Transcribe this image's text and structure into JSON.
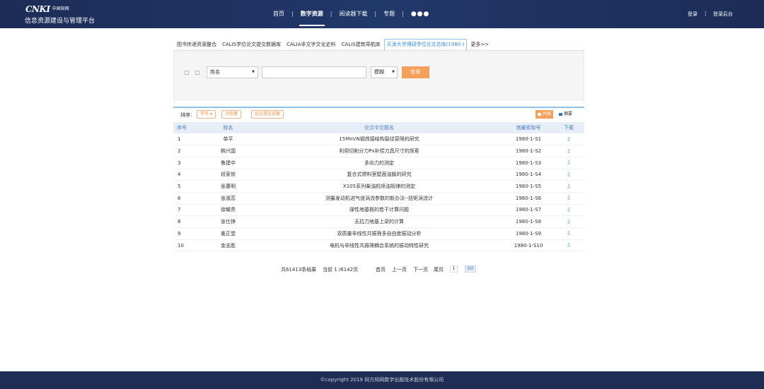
{
  "header": {
    "logo_text": "CNKI",
    "logo_sub": "中国知网",
    "platform": "信息资源建设与管理平台",
    "nav": [
      "首页",
      "数字资源",
      "阅读器下载",
      "专题",
      "●●●"
    ],
    "active_nav": "数字资源",
    "login": "登录",
    "admin": "登录后台"
  },
  "tabs": [
    "图书传递资源整合",
    "CALIS学位论文提交数据库",
    "CALIA非文字文化史料",
    "CALIS建筑导航库",
    "天津大学博硕学位论文总库(1980-)",
    "更多>>"
  ],
  "active_tab": "天津大学博硕学位论文总库(1980-)",
  "search": {
    "field": "姓名",
    "value": "",
    "match": "模糊",
    "button": "检索"
  },
  "sort": {
    "label": "排序:",
    "options": [
      "学号 ▾",
      "浏览量",
      "论文提交日期"
    ],
    "view_list": "列表",
    "view_abstract": "摘要"
  },
  "table": {
    "headers": [
      "序号",
      "姓名",
      "论文中文题名",
      "馆藏索取号",
      "下载"
    ],
    "rows": [
      [
        "1",
        "单平",
        "15MnVN钢焊接结构裂纹容限的研究",
        "1980-1-S1"
      ],
      [
        "2",
        "韩兴国",
        "利用切削分力Px补偿刀具尺寸的探索",
        "1980-1-S2"
      ],
      [
        "3",
        "鲁建中",
        "多向力的测定",
        "1980-1-S3"
      ],
      [
        "4",
        "段家修",
        "复合式燃料室壁面油膜的研究",
        "1980-1-S4"
      ],
      [
        "5",
        "张惠明",
        "X105系列柴油机喷油规律的测定",
        "1980-1-S5"
      ],
      [
        "6",
        "张淑蕊",
        "测量发动机进气道涡流参数的新办法--扭矩涡流计",
        "1980-1-S6"
      ],
      [
        "7",
        "徐耀责",
        "弹性地基板的若干计算问题",
        "1980-1-S7"
      ],
      [
        "8",
        "张仕铮",
        "无拉力地基上梁的计算",
        "1980-1-S8"
      ],
      [
        "9",
        "姜正堂",
        "双质量非线性共振筛多自由度振动分析",
        "1980-1-S9"
      ],
      [
        "10",
        "金志胜",
        "电机与非线性共振筛耦合系统的振动特性研究",
        "1980-1-S10"
      ]
    ],
    "download_icon": "download-icon"
  },
  "pagination": {
    "total": "共61413条结果",
    "current": "当前 1 /6142页",
    "first": "首页",
    "prev": "上一页",
    "next": "下一页",
    "last": "尾页",
    "page_input": "1",
    "go": "GO"
  },
  "footer": {
    "copyright": "©copyright 2019 同方知网数字出版技术股份有限公司"
  },
  "colors": {
    "header_bg": "#1c2c57",
    "accent_orange": "#f5a05a",
    "table_header_bg": "#e7eef8",
    "download_green": "#58b87a"
  }
}
